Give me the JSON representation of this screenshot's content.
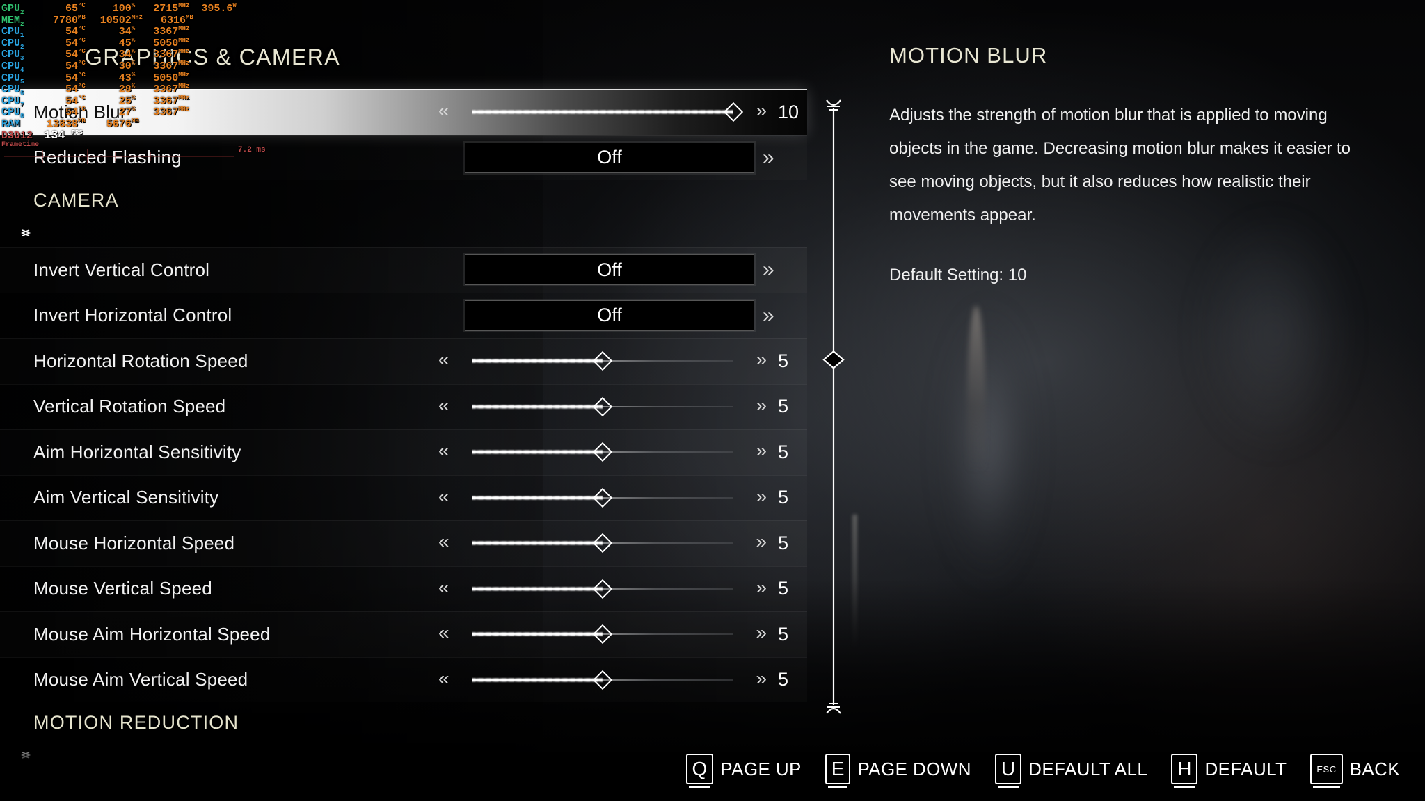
{
  "hud": {
    "rows": [
      {
        "label": "GPU",
        "sub": "2",
        "color": "green",
        "cells": [
          {
            "v": "65",
            "u": "°C"
          },
          {
            "v": "100",
            "u": "%"
          },
          {
            "v": "2715",
            "u": "MHz"
          },
          {
            "v": "395.6",
            "u": "W"
          }
        ]
      },
      {
        "label": "MEM",
        "sub": "2",
        "color": "green",
        "cells": [
          {
            "v": "7780",
            "u": "MB"
          },
          {
            "v": "10502",
            "u": "MHz"
          },
          {
            "v": "6316",
            "u": "MB"
          }
        ]
      },
      {
        "label": "CPU",
        "sub": "1",
        "color": "blue",
        "cells": [
          {
            "v": "54",
            "u": "°C"
          },
          {
            "v": "34",
            "u": "%"
          },
          {
            "v": "3367",
            "u": "MHz"
          }
        ]
      },
      {
        "label": "CPU",
        "sub": "2",
        "color": "blue",
        "cells": [
          {
            "v": "54",
            "u": "°C"
          },
          {
            "v": "45",
            "u": "%"
          },
          {
            "v": "5050",
            "u": "MHz"
          }
        ]
      },
      {
        "label": "CPU",
        "sub": "3",
        "color": "blue",
        "cells": [
          {
            "v": "54",
            "u": "°C"
          },
          {
            "v": "34",
            "u": "%"
          },
          {
            "v": "3367",
            "u": "MHz"
          }
        ]
      },
      {
        "label": "CPU",
        "sub": "4",
        "color": "blue",
        "cells": [
          {
            "v": "54",
            "u": "°C"
          },
          {
            "v": "30",
            "u": "%"
          },
          {
            "v": "3367",
            "u": "MHz"
          }
        ]
      },
      {
        "label": "CPU",
        "sub": "5",
        "color": "blue",
        "cells": [
          {
            "v": "54",
            "u": "°C"
          },
          {
            "v": "43",
            "u": "%"
          },
          {
            "v": "5050",
            "u": "MHz"
          }
        ]
      },
      {
        "label": "CPU",
        "sub": "6",
        "color": "blue",
        "cells": [
          {
            "v": "54",
            "u": "°C"
          },
          {
            "v": "28",
            "u": "%"
          },
          {
            "v": "3367",
            "u": "MHz"
          }
        ]
      },
      {
        "label": "CPU",
        "sub": "7",
        "color": "blue",
        "cells": [
          {
            "v": "54",
            "u": "°C"
          },
          {
            "v": "25",
            "u": "%"
          },
          {
            "v": "3367",
            "u": "MHz"
          }
        ]
      },
      {
        "label": "CPU",
        "sub": "8",
        "color": "blue",
        "cells": [
          {
            "v": "54",
            "u": "°C"
          },
          {
            "v": "27",
            "u": "%"
          },
          {
            "v": "3367",
            "u": "MHz"
          }
        ]
      },
      {
        "label": "RAM",
        "sub": "",
        "color": "blue",
        "cells": [
          {
            "v": "13838",
            "u": "MB"
          },
          {
            "v": "5676",
            "u": "MB"
          }
        ]
      }
    ],
    "api_label": "D3D12",
    "fps_value": "134",
    "fps_unit": "FPS",
    "frametime_label": "Frametime",
    "frametime_value": "7.2 ms"
  },
  "panel": {
    "title": "GRAPHICS & CAMERA"
  },
  "rows": [
    {
      "kind": "slider",
      "name": "motion-blur",
      "label": "Motion Blur",
      "value": "10",
      "pct": 100,
      "selected": true
    },
    {
      "kind": "toggle",
      "name": "reduced-flashing",
      "label": "Reduced Flashing",
      "value": "Off"
    },
    {
      "kind": "section",
      "name": "camera",
      "label": "CAMERA"
    },
    {
      "kind": "toggle",
      "name": "invert-vertical",
      "label": "Invert Vertical Control",
      "value": "Off"
    },
    {
      "kind": "toggle",
      "name": "invert-horizontal",
      "label": "Invert Horizontal Control",
      "value": "Off"
    },
    {
      "kind": "slider",
      "name": "horizontal-rotation",
      "label": "Horizontal Rotation Speed",
      "value": "5",
      "pct": 50
    },
    {
      "kind": "slider",
      "name": "vertical-rotation",
      "label": "Vertical Rotation Speed",
      "value": "5",
      "pct": 50
    },
    {
      "kind": "slider",
      "name": "aim-horizontal",
      "label": "Aim Horizontal Sensitivity",
      "value": "5",
      "pct": 50
    },
    {
      "kind": "slider",
      "name": "aim-vertical",
      "label": "Aim Vertical Sensitivity",
      "value": "5",
      "pct": 50
    },
    {
      "kind": "slider",
      "name": "mouse-horizontal",
      "label": "Mouse Horizontal Speed",
      "value": "5",
      "pct": 50
    },
    {
      "kind": "slider",
      "name": "mouse-vertical",
      "label": "Mouse Vertical Speed",
      "value": "5",
      "pct": 50
    },
    {
      "kind": "slider",
      "name": "mouse-aim-horizontal",
      "label": "Mouse Aim Horizontal Speed",
      "value": "5",
      "pct": 50
    },
    {
      "kind": "slider",
      "name": "mouse-aim-vertical",
      "label": "Mouse Aim Vertical Speed",
      "value": "5",
      "pct": 50
    },
    {
      "kind": "section",
      "name": "motion-reduction",
      "label": "MOTION REDUCTION"
    }
  ],
  "chevrons": {
    "left": "«",
    "right": "»"
  },
  "scrollbar": {
    "thumb_pct": 42
  },
  "description": {
    "title": "MOTION BLUR",
    "body": "Adjusts the strength of motion blur that is applied to moving objects in the game. Decreasing motion blur makes it easier to see moving objects, but it also reduces how realistic their movements appear.",
    "default_setting": "Default Setting: 10"
  },
  "keybar": [
    {
      "key": "Q",
      "label": "PAGE UP",
      "esc": false
    },
    {
      "key": "E",
      "label": "PAGE DOWN",
      "esc": false
    },
    {
      "key": "U",
      "label": "DEFAULT ALL",
      "esc": false
    },
    {
      "key": "H",
      "label": "DEFAULT",
      "esc": false
    },
    {
      "key": "ESC",
      "label": "BACK",
      "esc": true
    }
  ],
  "colors": {
    "cream": "#e8e6d2",
    "text": "#f2f2f2",
    "hud_green": "#2fbf6e",
    "hud_blue": "#29a3e0",
    "hud_orange": "#e8811f",
    "hud_red": "#c04a4a"
  }
}
